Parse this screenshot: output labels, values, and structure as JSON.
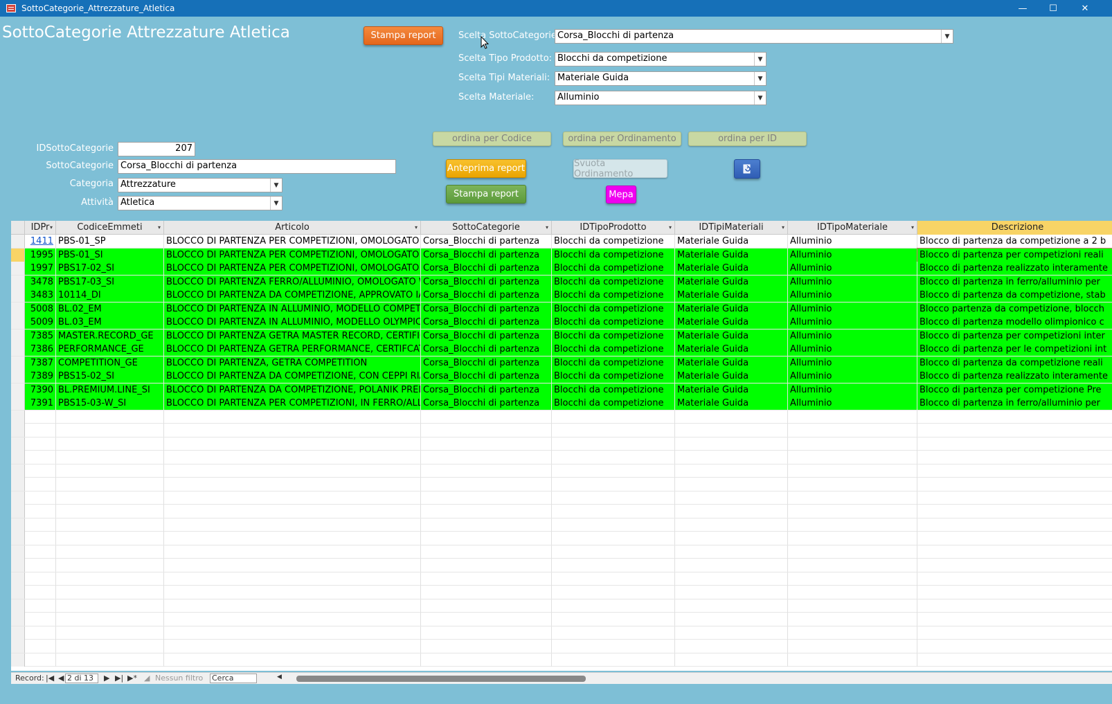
{
  "window": {
    "title": "SottoCategorie_Attrezzature_Atletica"
  },
  "form": {
    "title": "SottoCategorie Attrezzature Atletica",
    "btn_stampa_top": "Stampa report",
    "filters": {
      "sottocategorie_label": "Scelta SottoCategorie:",
      "sottocategorie_value": "Corsa_Blocchi di partenza",
      "tipo_prodotto_label": "Scelta Tipo Prodotto:",
      "tipo_prodotto_value": "Blocchi da competizione",
      "tipi_materiali_label": "Scelta Tipi Materiali:",
      "tipi_materiali_value": "Materiale Guida",
      "materiale_label": "Scelta Materiale:",
      "materiale_value": "Alluminio"
    },
    "record": {
      "id_label": "IDSottoCategorie",
      "id_value": "207",
      "sottocat_label": "SottoCategorie",
      "sottocat_value": "Corsa_Blocchi di partenza",
      "categoria_label": "Categoria",
      "categoria_value": "Attrezzature",
      "attivita_label": "Attività",
      "attivita_value": "Atletica"
    },
    "buttons": {
      "ordina_codice": "ordina per Codice",
      "ordina_ordinamento": "ordina per Ordinamento",
      "ordina_id": "ordina per ID",
      "anteprima": "Anteprima report",
      "svuota": "Svuota Ordinamento",
      "stampa": "Stampa report",
      "mepa": "Mepa"
    }
  },
  "table": {
    "columns": [
      "IDPr",
      "CodiceEmmeti",
      "Articolo",
      "SottoCategorie",
      "IDTipoProdotto",
      "IDTipiMateriali",
      "IDTipoMateriale",
      "Descrizione"
    ],
    "rows": [
      {
        "id": "1411",
        "codice": "PBS-01_SP",
        "articolo": "BLOCCO DI PARTENZA PER COMPETIZIONI, OMOLOGATO WA,",
        "sottocat": "Corsa_Blocchi di partenza",
        "tipo": "Blocchi da competizione",
        "tipi": "Materiale Guida",
        "materiale": "Alluminio",
        "descr": "Blocco di partenza da competizione a 2 b",
        "green": false
      },
      {
        "id": "1995",
        "codice": "PBS-01_SI",
        "articolo": "BLOCCO DI PARTENZA PER COMPETIZIONI, OMOLOGATO WA,",
        "sottocat": "Corsa_Blocchi di partenza",
        "tipo": "Blocchi da competizione",
        "tipi": "Materiale Guida",
        "materiale": "Alluminio",
        "descr": "Blocco di partenza per competizioni reali",
        "green": true
      },
      {
        "id": "1997",
        "codice": "PBS17-02_SI",
        "articolo": "BLOCCO DI PARTENZA PER COMPETIZIONI, OMOLOGATO WA,",
        "sottocat": "Corsa_Blocchi di partenza",
        "tipo": "Blocchi da competizione",
        "tipi": "Materiale Guida",
        "materiale": "Alluminio",
        "descr": "Blocco di partenza realizzato interamente",
        "green": true
      },
      {
        "id": "3478",
        "codice": "PBS17-03_SI",
        "articolo": "BLOCCO DI PARTENZA FERRO/ALLUMINIO, OMOLOGATO WA",
        "sottocat": "Corsa_Blocchi di partenza",
        "tipo": "Blocchi da competizione",
        "tipi": "Materiale Guida",
        "materiale": "Alluminio",
        "descr": "Blocco di partenza in ferro/alluminio per",
        "green": true
      },
      {
        "id": "3483",
        "codice": "10114_DI",
        "articolo": "BLOCCO DI PARTENZA DA COMPETIZIONE, APPROVATO IAAF",
        "sottocat": "Corsa_Blocchi di partenza",
        "tipo": "Blocchi da competizione",
        "tipi": "Materiale Guida",
        "materiale": "Alluminio",
        "descr": "Blocco di partenza da competizione, stab",
        "green": true
      },
      {
        "id": "5008",
        "codice": "BL.02_EM",
        "articolo": "BLOCCO DI PARTENZA IN ALLUMINIO, MODELLO COMPETITIO",
        "sottocat": "Corsa_Blocchi di partenza",
        "tipo": "Blocchi da competizione",
        "tipi": "Materiale Guida",
        "materiale": "Alluminio",
        "descr": "Blocco partenza da competizione, blocch",
        "green": true
      },
      {
        "id": "5009",
        "codice": "BL.03_EM",
        "articolo": "BLOCCO DI PARTENZA IN ALLUMINIO, MODELLO OLYMPIC",
        "sottocat": "Corsa_Blocchi di partenza",
        "tipo": "Blocchi da competizione",
        "tipi": "Materiale Guida",
        "materiale": "Alluminio",
        "descr": "Blocco di partenza modello olimpionico c",
        "green": true
      },
      {
        "id": "7385",
        "codice": "MASTER.RECORD_GE",
        "articolo": "BLOCCO DI PARTENZA GETRA MASTER RECORD, CERTIFICATO",
        "sottocat": "Corsa_Blocchi di partenza",
        "tipo": "Blocchi da competizione",
        "tipi": "Materiale Guida",
        "materiale": "Alluminio",
        "descr": "Blocco di partenza per competizioni inter",
        "green": true
      },
      {
        "id": "7386",
        "codice": "PERFORMANCE_GE",
        "articolo": "BLOCCO DI PARTENZA GETRA PERFORMANCE, CERTIFCATO W",
        "sottocat": "Corsa_Blocchi di partenza",
        "tipo": "Blocchi da competizione",
        "tipi": "Materiale Guida",
        "materiale": "Alluminio",
        "descr": "Blocco di partenza per le competizioni int",
        "green": true
      },
      {
        "id": "7387",
        "codice": "COMPETITION_GE",
        "articolo": "BLOCCO DI PARTENZA, GETRA COMPETITION",
        "sottocat": "Corsa_Blocchi di partenza",
        "tipo": "Blocchi da competizione",
        "tipi": "Materiale Guida",
        "materiale": "Alluminio",
        "descr": "Blocco di partenza da competizione reali",
        "green": true
      },
      {
        "id": "7389",
        "codice": "PBS15-02_SI",
        "articolo": "BLOCCO DI PARTENZA DA COMPETIZIONE, CON CEPPI RIALZA",
        "sottocat": "Corsa_Blocchi di partenza",
        "tipo": "Blocchi da competizione",
        "tipi": "Materiale Guida",
        "materiale": "Alluminio",
        "descr": "Blocco di partenza realizzato interamente",
        "green": true
      },
      {
        "id": "7390",
        "codice": "BL.PREMIUM.LINE_SI",
        "articolo": "BLOCCO DI PARTENZA DA COMPETIZIONE, POLANIK PREMIUN",
        "sottocat": "Corsa_Blocchi di partenza",
        "tipo": "Blocchi da competizione",
        "tipi": "Materiale Guida",
        "materiale": "Alluminio",
        "descr": "Blocco di partenza per competizione Pre",
        "green": true
      },
      {
        "id": "7391",
        "codice": "PBS15-03-W_SI",
        "articolo": "BLOCCO DI PARTENZA PER COMPETIZIONI, IN FERRO/ALLUMI",
        "sottocat": "Corsa_Blocchi di partenza",
        "tipo": "Blocchi da competizione",
        "tipi": "Materiale Guida",
        "materiale": "Alluminio",
        "descr": "Blocco di partenza in ferro/alluminio per",
        "green": true
      }
    ]
  },
  "status": {
    "record_label": "Record:",
    "record_pos": "2 di 13",
    "filter": "Nessun filtro",
    "search": "Cerca"
  },
  "colors": {
    "background": "#7ebfd6",
    "row_highlight": "#00ff00",
    "titlebar": "#1670b8"
  }
}
